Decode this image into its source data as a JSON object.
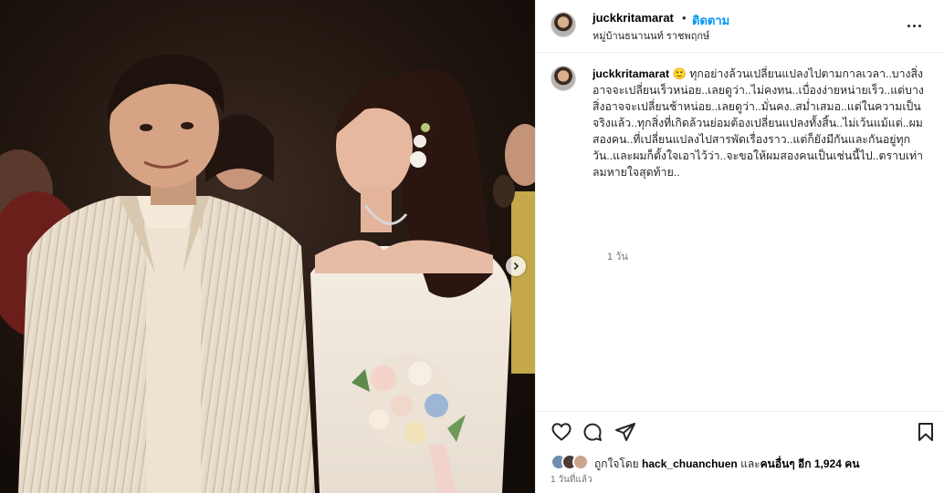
{
  "post": {
    "username": "juckkritamarat",
    "separator": "•",
    "follow_label": "ติดตาม",
    "location": "หมู่บ้านธนานนท์ ราชพฤกษ์",
    "caption": "ทุกอย่างล้วนเปลี่ยนแปลงไปตามกาลเวลา..บางสิ่งอาจจะเปลี่ยนเร็วหน่อย..เลยดูว่า..ไม่คงทน..เบื่องง่ายหน่ายเร็ว..แต่บางสิ่งอาจจะเปลี่ยนช้าหน่อย..เลยดูว่า..มั่นคง..สม่ำเสมอ..แต่ในความเป็นจริงแล้ว..ทุกสิ่งที่เกิดล้วนย่อมต้องเปลี่ยนแปลงทั้งสิ้น..ไม่เว้นแม้แต่..ผมสองคน..ที่เปลี่ยนแปลงไปสารพัดเรื่องราว..แต่ก็ยังมีกันและกันอยู่ทุกวัน..และผมก็ตั้งใจเอาไว้ว่า..จะขอให้ผมสองคนเป็นเช่นนี้ไป..ตราบเท่าลมหายใจสุดท้าย..",
    "caption_emoji": "🙂",
    "caption_time": "1 วัน",
    "likes_prefix": "ถูกใจโดย",
    "likes_user": "hack_chuanchuen",
    "likes_and": "และ",
    "likes_others": "คนอื่นๆ อีก 1,924 คน",
    "post_time": "1 วันที่แล้ว"
  },
  "icons": {
    "like": "heart-icon",
    "comment": "comment-icon",
    "share": "send-icon",
    "save": "bookmark-icon",
    "more": "more-options-icon",
    "next": "chevron-right-icon"
  },
  "colors": {
    "accent": "#0095f6",
    "text": "#262626",
    "muted": "#737373",
    "divider": "#efefef"
  }
}
